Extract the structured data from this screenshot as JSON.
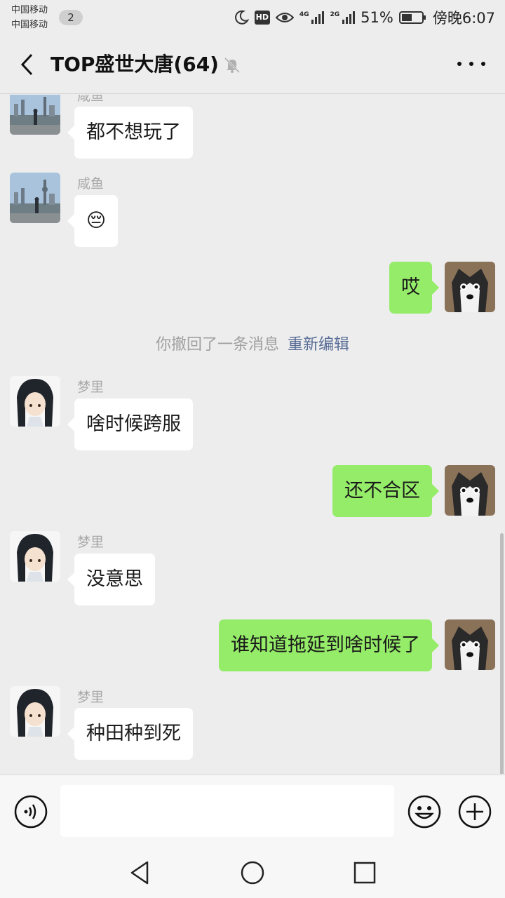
{
  "status_bar": {
    "carrier_1": "中国移动",
    "carrier_2": "中国移动",
    "notification_count": "2",
    "hd_label": "HD",
    "net_4g": "4G",
    "net_2g": "2G",
    "battery_percent": "51%",
    "battery_level": 0.51,
    "time": "傍晚6:07"
  },
  "header": {
    "title": "TOP盛世大唐(64)",
    "muted": true
  },
  "messages": [
    {
      "side": "in",
      "sender": "咸鱼",
      "text": "都不想玩了",
      "avatar": "city-skyline-avatar"
    },
    {
      "side": "in",
      "sender": "咸鱼",
      "text": "😔",
      "avatar": "city-skyline-avatar"
    },
    {
      "side": "out",
      "text": "哎",
      "avatar": "husky-avatar"
    },
    {
      "side": "in",
      "sender": "梦里",
      "text": "啥时候跨服",
      "avatar": "anime-avatar"
    },
    {
      "side": "out",
      "text": "还不合区",
      "avatar": "husky-avatar"
    },
    {
      "side": "in",
      "sender": "梦里",
      "text": "没意思",
      "avatar": "anime-avatar"
    },
    {
      "side": "out",
      "text": "谁知道拖延到啥时候了",
      "avatar": "husky-avatar"
    },
    {
      "side": "in",
      "sender": "梦里",
      "text": "种田种到死",
      "avatar": "anime-avatar"
    }
  ],
  "system_notice": {
    "text": "你撤回了一条消息",
    "link": "重新编辑"
  },
  "colors": {
    "background": "#ededed",
    "outgoing_bubble": "#95ec69",
    "incoming_bubble": "#ffffff",
    "link": "#576b95"
  },
  "input": {
    "value": "",
    "placeholder": ""
  }
}
